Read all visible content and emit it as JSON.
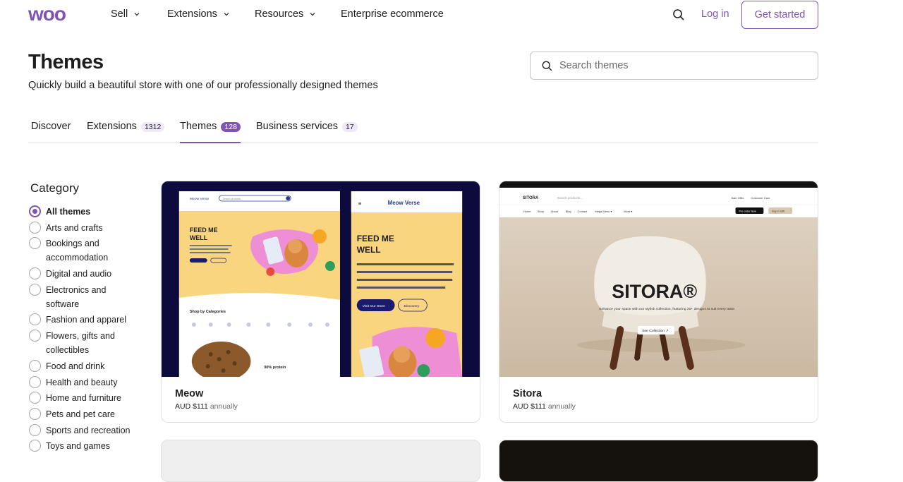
{
  "nav": {
    "logo_text": "woo",
    "items": [
      {
        "label": "Sell",
        "dropdown": true
      },
      {
        "label": "Extensions",
        "dropdown": true
      },
      {
        "label": "Resources",
        "dropdown": true
      },
      {
        "label": "Enterprise ecommerce",
        "dropdown": false
      }
    ],
    "login_label": "Log in",
    "get_started_label": "Get started",
    "accent_color": "#7f54b3"
  },
  "header": {
    "title": "Themes",
    "subtitle": "Quickly build a beautiful store with one of our professionally designed themes",
    "search_placeholder": "Search themes"
  },
  "tabs": [
    {
      "label": "Discover",
      "count": null,
      "active": false
    },
    {
      "label": "Extensions",
      "count": "1312",
      "active": false
    },
    {
      "label": "Themes",
      "count": "128",
      "active": true
    },
    {
      "label": "Business services",
      "count": "17",
      "active": false
    }
  ],
  "category": {
    "title": "Category",
    "items": [
      {
        "label": "All themes",
        "selected": true
      },
      {
        "label": "Arts and crafts",
        "selected": false
      },
      {
        "label": "Bookings and accommodation",
        "selected": false
      },
      {
        "label": "Digital and audio",
        "selected": false
      },
      {
        "label": "Electronics and software",
        "selected": false
      },
      {
        "label": "Fashion and apparel",
        "selected": false
      },
      {
        "label": "Flowers, gifts and collectibles",
        "selected": false
      },
      {
        "label": "Food and drink",
        "selected": false
      },
      {
        "label": "Health and beauty",
        "selected": false
      },
      {
        "label": "Home and furniture",
        "selected": false
      },
      {
        "label": "Pets and pet care",
        "selected": false
      },
      {
        "label": "Sports and recreation",
        "selected": false
      },
      {
        "label": "Toys and games",
        "selected": false
      }
    ]
  },
  "themes": [
    {
      "name": "Meow",
      "price": "AUD $111",
      "period": "annually",
      "preview": {
        "brand": "Meow Verse",
        "headline1": "FEED ME",
        "headline2": "WELL",
        "body": "We are a small business with a great love for animals, we believe our love will find the same hearts because our fluffy fellas deserve better with more snack.",
        "btn_primary": "Visit Our Store",
        "btn_secondary": "Discovery",
        "section": "Shop by Categories",
        "search": "Search products...",
        "protein": "90% protein"
      }
    },
    {
      "name": "Sitora",
      "price": "AUD $111",
      "period": "annually",
      "preview": {
        "brand": "SITORA",
        "hero": "SITORA®",
        "tagline": "Enhance your space with our stylish collection, featuring 20+ designs to suit every taste.",
        "cta": "See Collection ↗",
        "search": "Search products...",
        "menu": [
          "Home",
          "Shop",
          "About",
          "Blog",
          "Contact",
          "Mega Menu ▾",
          "More ▾"
        ],
        "sale": "Sale Offer",
        "care": "Customer Care",
        "preorder": "Pre-order Now",
        "buy": "Buy in Gift"
      }
    }
  ]
}
